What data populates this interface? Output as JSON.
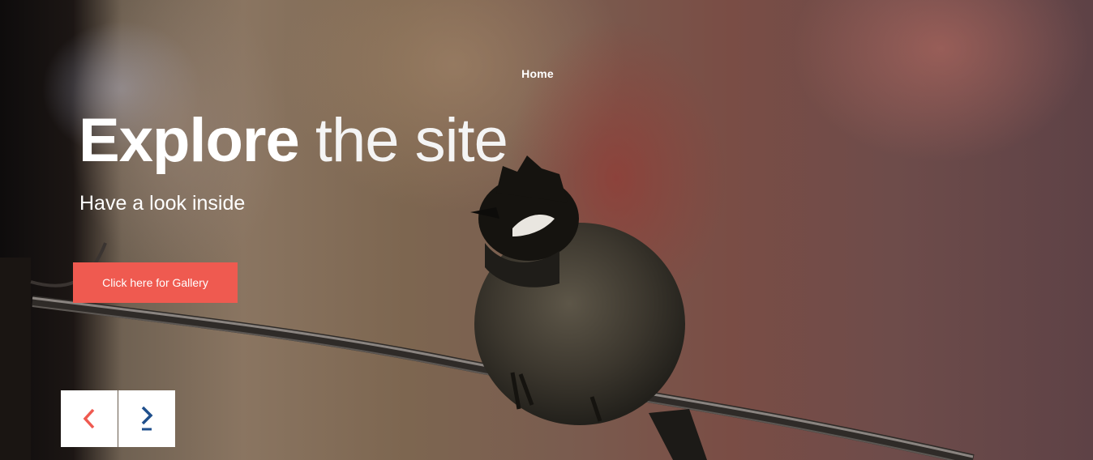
{
  "nav": {
    "home_label": "Home"
  },
  "hero": {
    "title_bold": "Explore",
    "title_light": " the site",
    "subtitle": "Have a look inside",
    "button_label": "Click here for Gallery"
  },
  "slider": {
    "prev_icon": "chevron-left-icon",
    "next_icon": "chevron-right-icon"
  },
  "colors": {
    "accent": "#ef5a50",
    "next_arrow": "#1f4f8c",
    "text": "#ffffff"
  }
}
